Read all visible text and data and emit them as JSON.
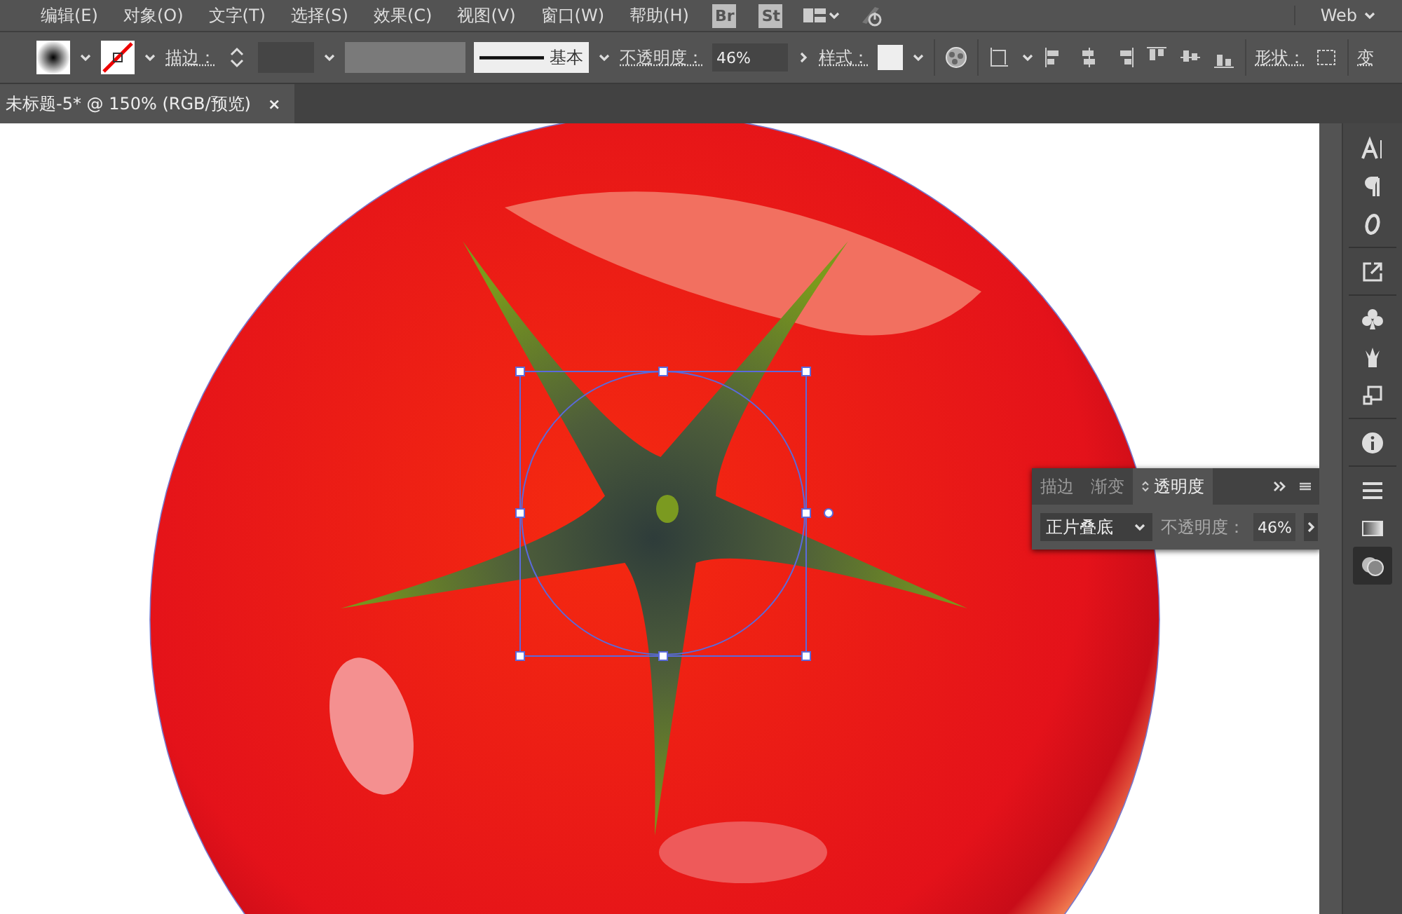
{
  "menu_bar": {
    "items": [
      "编辑(E)",
      "对象(O)",
      "文字(T)",
      "选择(S)",
      "效果(C)",
      "视图(V)",
      "窗口(W)",
      "帮助(H)"
    ],
    "badges": [
      "Br",
      "St"
    ],
    "workspace": "Web"
  },
  "control_bar": {
    "stroke_label": "描边：",
    "stroke_profile": "基本",
    "opacity_label": "不透明度：",
    "opacity": "46%",
    "style_label": "样式：",
    "shape_label": "形状：",
    "transform_label": "变"
  },
  "document_tab": {
    "title": "未标题-5* @ 150% (RGB/预览)",
    "close": "×"
  },
  "transparency_panel": {
    "tabs": [
      {
        "label": "描边",
        "selected": false
      },
      {
        "label": "渐变",
        "selected": false
      },
      {
        "label": "透明度",
        "selected": true
      }
    ],
    "blend_mode": "正片叠底",
    "opacity_label": "不透明度：",
    "opacity": "46%"
  },
  "dock": {
    "items": [
      {
        "kind": "character",
        "selected": false
      },
      {
        "kind": "paragraph",
        "selected": false
      },
      {
        "kind": "opentype",
        "selected": false
      },
      {
        "kind": "export",
        "selected": false
      },
      {
        "kind": "symbols",
        "selected": false
      },
      {
        "kind": "brushes",
        "selected": false
      },
      {
        "kind": "transform",
        "selected": false
      },
      {
        "kind": "info",
        "selected": false
      },
      {
        "kind": "stroke",
        "selected": false
      },
      {
        "kind": "gradient",
        "selected": false
      },
      {
        "kind": "transparency",
        "selected": true
      }
    ]
  }
}
